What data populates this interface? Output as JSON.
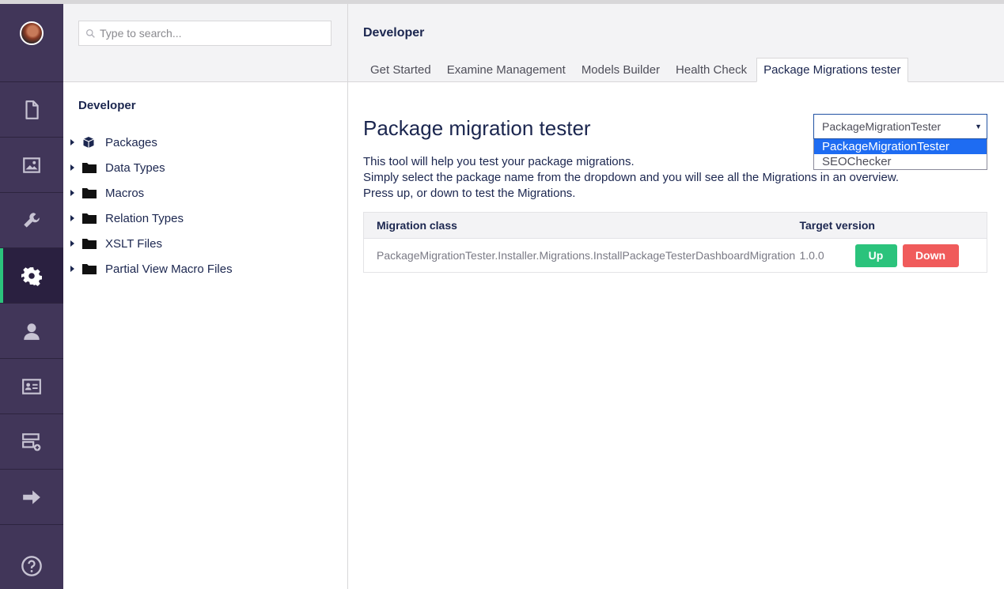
{
  "sidebar": {
    "items": [
      {
        "icon": "document-icon",
        "label": "Content"
      },
      {
        "icon": "image-icon",
        "label": "Media"
      },
      {
        "icon": "wrench-icon",
        "label": "Settings"
      },
      {
        "icon": "gear-icon",
        "label": "Developer",
        "active": true
      },
      {
        "icon": "user-icon",
        "label": "Users"
      },
      {
        "icon": "id-card-icon",
        "label": "Members"
      },
      {
        "icon": "form-icon",
        "label": "Forms"
      },
      {
        "icon": "arrow-right-icon",
        "label": "Translation"
      }
    ],
    "help_icon": "help-icon",
    "active_color": "#2bc37c",
    "background_color": "#413659"
  },
  "tree": {
    "search_placeholder": "Type to search...",
    "title": "Developer",
    "nodes": [
      {
        "label": "Packages",
        "icon": "package-icon"
      },
      {
        "label": "Data Types",
        "icon": "folder-icon"
      },
      {
        "label": "Macros",
        "icon": "folder-icon"
      },
      {
        "label": "Relation Types",
        "icon": "folder-icon"
      },
      {
        "label": "XSLT Files",
        "icon": "folder-icon"
      },
      {
        "label": "Partial View Macro Files",
        "icon": "folder-icon"
      }
    ]
  },
  "header": {
    "section_title": "Developer",
    "tabs": [
      {
        "label": "Get Started"
      },
      {
        "label": "Examine Management"
      },
      {
        "label": "Models Builder"
      },
      {
        "label": "Health Check"
      },
      {
        "label": "Package Migrations tester",
        "active": true
      }
    ]
  },
  "main": {
    "title": "Package migration tester",
    "description": [
      "This tool will help you test your package migrations.",
      "Simply select the package name from the dropdown and you will see all the Migrations in an overview.",
      "Press up, or down to test the Migrations."
    ],
    "package_select": {
      "value": "PackageMigrationTester",
      "options": [
        "PackageMigrationTester",
        "SEOChecker"
      ],
      "highlighted": "PackageMigrationTester"
    },
    "table": {
      "headers": [
        "Migration class",
        "Target version"
      ],
      "rows": [
        {
          "migration_class": "PackageMigrationTester.Installer.Migrations.InstallPackageTesterDashboardMigration",
          "target_version": "1.0.0",
          "up_label": "Up",
          "down_label": "Down"
        }
      ]
    },
    "colors": {
      "up": "#2bc37c",
      "down": "#f05b5b",
      "select_highlight": "#1e6cf2"
    }
  }
}
